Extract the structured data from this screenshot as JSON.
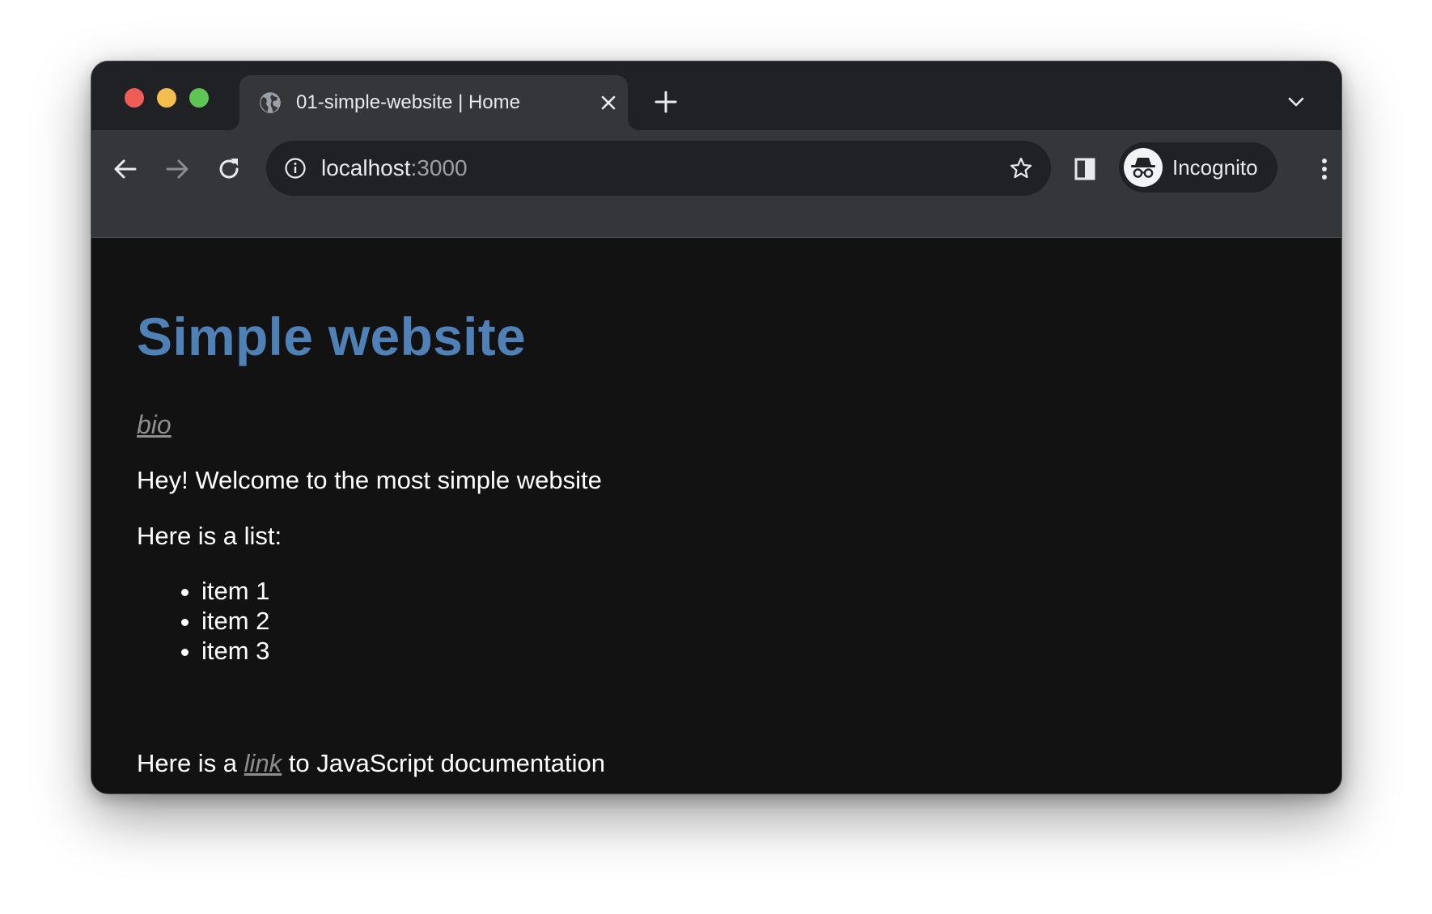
{
  "tab": {
    "title": "01-simple-website | Home",
    "favicon": "globe-icon"
  },
  "omnibox": {
    "host": "localhost",
    "port": ":3000"
  },
  "profile": {
    "label": "Incognito",
    "icon": "incognito-icon"
  },
  "page": {
    "heading": "Simple website",
    "bio_link": "bio",
    "welcome": "Hey! Welcome to the most simple website",
    "list_intro": "Here is a list:",
    "list_items": [
      "item 1",
      "item 2",
      "item 3"
    ],
    "link_prefix": "Here is a ",
    "link_text": "link",
    "link_suffix": " to JavaScript documentation"
  },
  "colors": {
    "heading": "#5081b6",
    "link": "#8e8e8e",
    "page_bg": "#121212",
    "tabstrip_bg": "#202124",
    "toolbar_bg": "#35363a"
  }
}
